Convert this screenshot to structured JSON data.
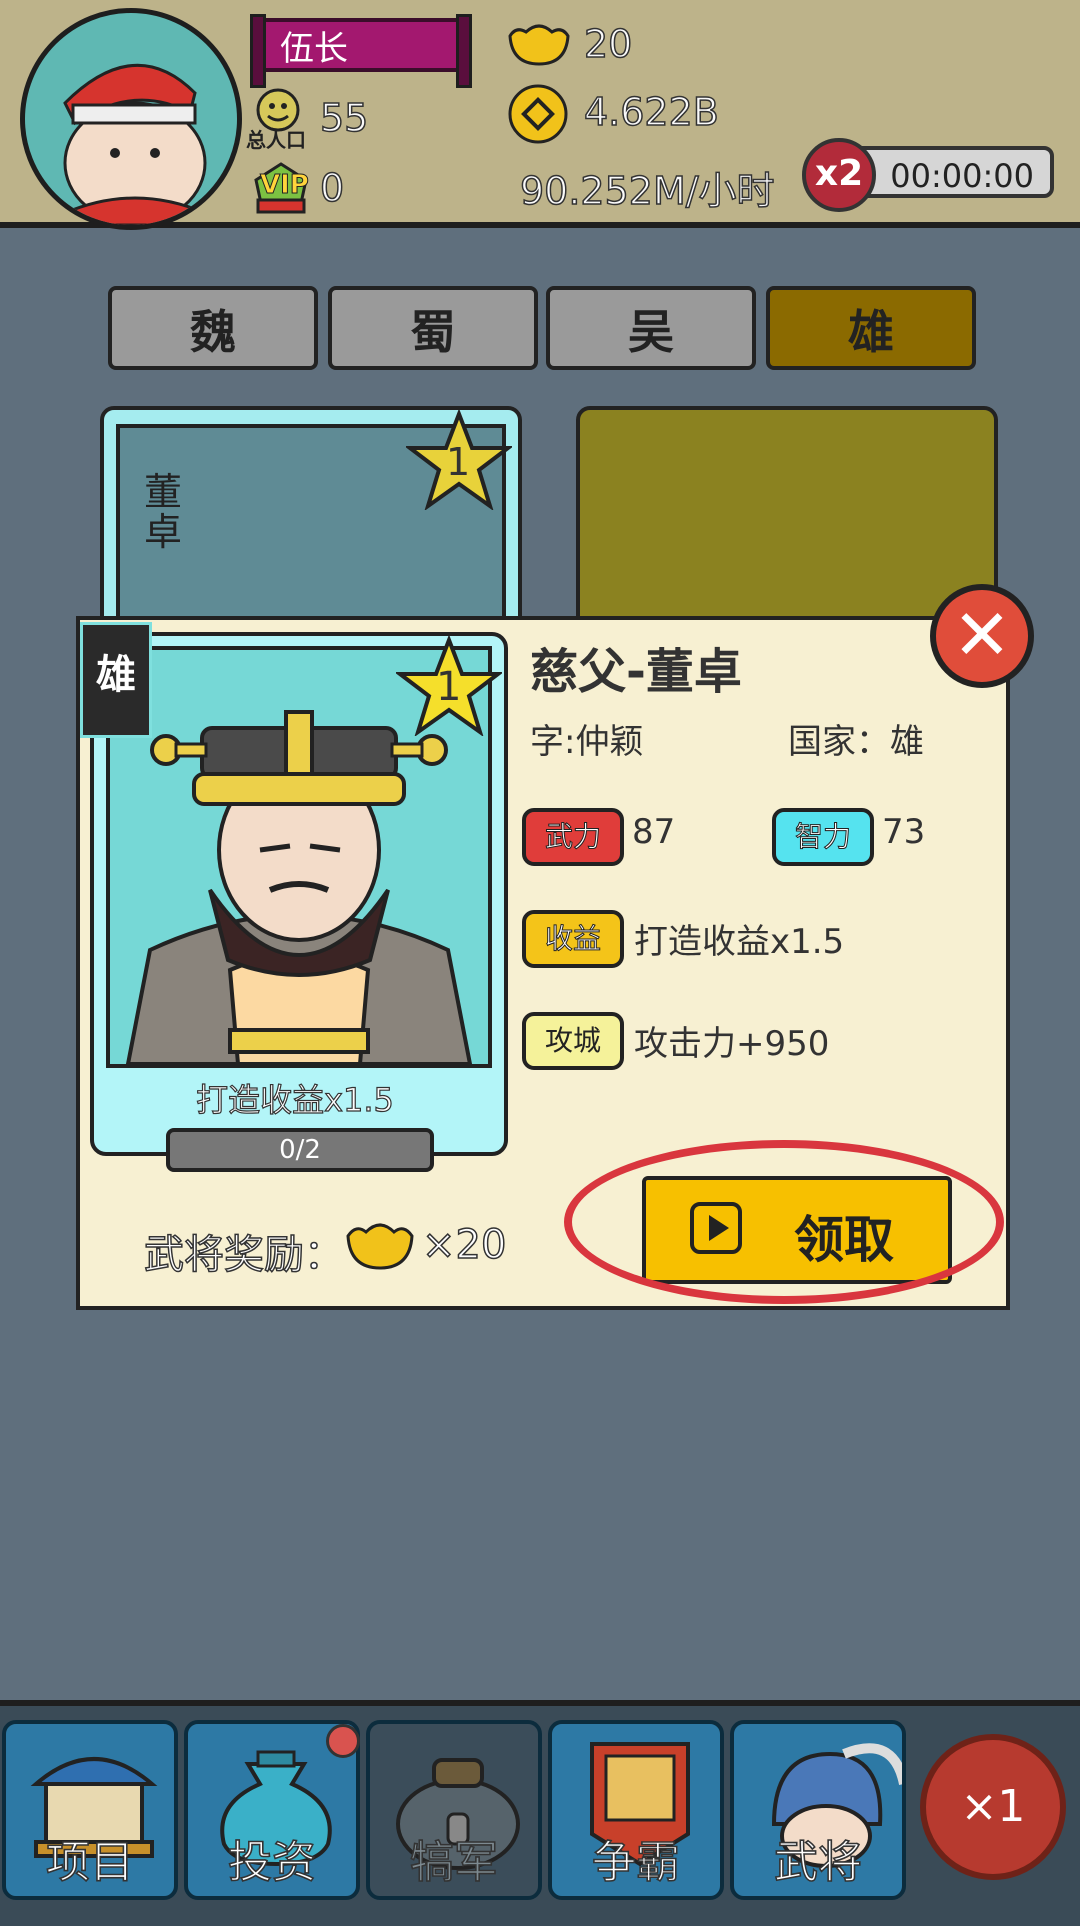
{
  "header": {
    "rank_title": "伍长",
    "population_label": "总人口",
    "population": "55",
    "vip_label": "VIP",
    "vip_level": "0",
    "ingots": "20",
    "coins": "4.622B",
    "income_rate": "90.252M/小时",
    "boost_label": "x2",
    "boost_timer": "00:00:00"
  },
  "tabs": [
    {
      "label": "魏",
      "active": false
    },
    {
      "label": "蜀",
      "active": false
    },
    {
      "label": "吴",
      "active": false
    },
    {
      "label": "雄",
      "active": true
    }
  ],
  "background_card": {
    "name": "董卓",
    "star_level": "1"
  },
  "dialog": {
    "faction_banner": "雄",
    "star_level": "1",
    "card_bonus": "打造收益x1.5",
    "progress": "0/2",
    "hero_name": "慈父-董卓",
    "courtesy_name": "字:仲颖",
    "country": "国家：雄",
    "force_label": "武力",
    "force_value": "87",
    "intel_label": "智力",
    "intel_value": "73",
    "income_label": "收益",
    "income_value": "打造收益x1.5",
    "siege_label": "攻城",
    "siege_value": "攻击力+950",
    "reward_label": "武将奖励：",
    "reward_amount": "×20",
    "claim_label": "领取",
    "close_symbol": "✕"
  },
  "bottom_nav": [
    {
      "label": "项目",
      "dim": false
    },
    {
      "label": "投资",
      "dim": false
    },
    {
      "label": "犒军",
      "dim": true
    },
    {
      "label": "争霸",
      "dim": false
    },
    {
      "label": "武将",
      "dim": false
    }
  ],
  "speed_label": "×1",
  "colors": {
    "accent_yellow": "#f7c000",
    "close_red": "#e04d3a",
    "highlight_ring": "#d9363e",
    "active_tab": "#8b6a00"
  }
}
